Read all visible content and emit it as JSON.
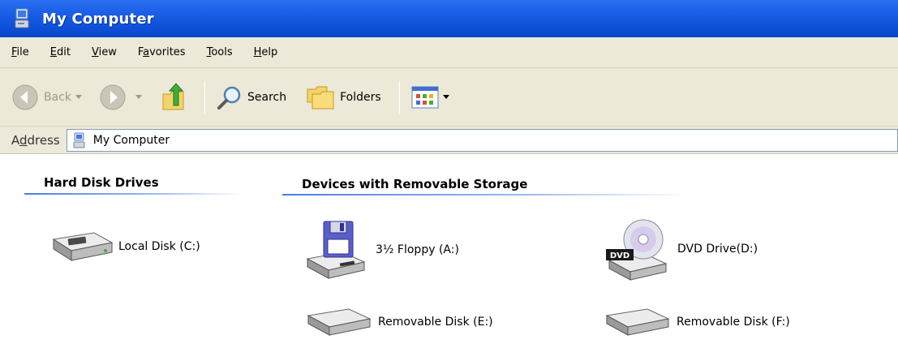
{
  "window": {
    "title": "My Computer",
    "icon": "my-computer-icon"
  },
  "menubar": {
    "items": [
      {
        "label_u": "F",
        "label_rest": "ile"
      },
      {
        "label_u": "E",
        "label_rest": "dit"
      },
      {
        "label_u": "V",
        "label_rest": "iew"
      },
      {
        "label_pre": "F",
        "label_u": "a",
        "label_rest": "vorites"
      },
      {
        "label_u": "T",
        "label_rest": "ools"
      },
      {
        "label_u": "H",
        "label_rest": "elp"
      }
    ]
  },
  "toolbar": {
    "back_label": "Back",
    "search_label": "Search",
    "folders_label": "Folders"
  },
  "address": {
    "label_pre": "A",
    "label_u": "d",
    "label_rest": "dress",
    "value": "My Computer"
  },
  "content": {
    "hard_disk_header": "Hard Disk Drives",
    "removable_header": "Devices with Removable Storage",
    "hard_disks": [
      {
        "label": "Local Disk (C:)"
      }
    ],
    "removable": [
      {
        "label": "3½ Floppy (A:)"
      },
      {
        "label": "DVD Drive(D:)",
        "badge": "DVD"
      },
      {
        "label": "Removable Disk (E:)"
      },
      {
        "label": "Removable Disk (F:)"
      }
    ]
  },
  "colors": {
    "titlebar": "#0c4fd8",
    "chrome": "#ece9d8",
    "group_line": "#4b7de0"
  }
}
